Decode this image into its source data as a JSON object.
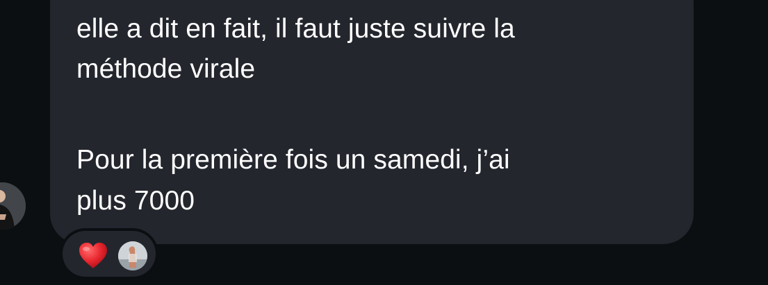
{
  "message": {
    "lines": [
      "elle a dit en fait, il faut juste suivre la",
      "méthode virale",
      "Pour la première fois un samedi, j’ai",
      "plus 7000"
    ]
  },
  "reactions": {
    "emoji_icon": "red-heart-icon",
    "reactor_icon": "user-avatar",
    "heart_color": "#e8272f"
  },
  "colors": {
    "background": "#0c0f12",
    "bubble": "#24262e",
    "text": "#ffffff"
  }
}
